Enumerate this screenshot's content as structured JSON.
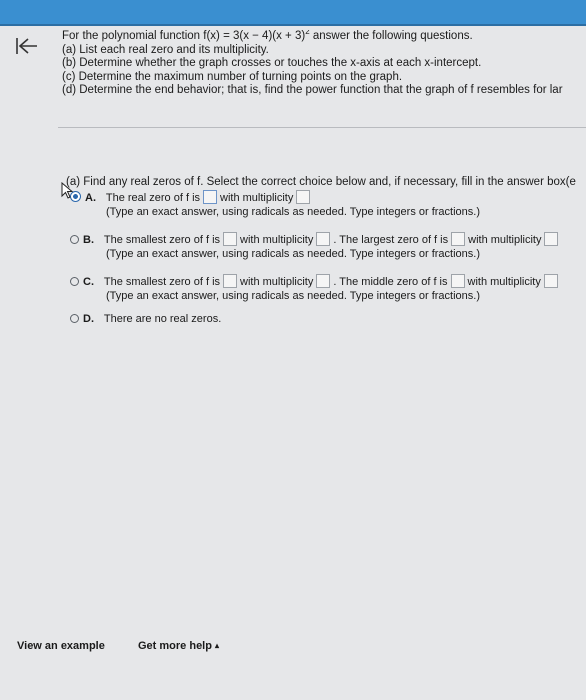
{
  "question": {
    "prompt_start": "For the polynomial function f(x) = 3(x − 4)(x + 3)",
    "exponent": "2",
    "prompt_end": " answer the following questions.",
    "tasks": [
      "(a) List each real zero and its multiplicity.",
      "(b) Determine whether the graph crosses or touches the x-axis at each x-intercept.",
      "(c) Determine the maximum number of turning points on the graph.",
      "(d) Determine the end behavior; that is, find the power function that the graph of f resembles for lar"
    ]
  },
  "part_a": {
    "instruction": "(a) Find any real zeros of f. Select the correct choice below and, if necessary, fill in the answer box(e",
    "choices": [
      {
        "letter": "A.",
        "t1": "The real zero of f is",
        "t2": "with multiplicity",
        "note": "(Type an exact answer, using radicals as needed. Type integers or fractions.)"
      },
      {
        "letter": "B.",
        "t1": "The smallest zero of f is",
        "t2": "with multiplicity",
        "t3": ". The largest zero of f is",
        "t4": "with multiplicity",
        "note": "(Type an exact answer, using radicals as needed. Type integers or fractions.)"
      },
      {
        "letter": "C.",
        "t1": "The smallest zero of f is",
        "t2": "with multiplicity",
        "t3": ". The middle zero of f is",
        "t4": "with multiplicity",
        "note": "(Type an exact answer, using radicals as needed. Type integers or fractions.)"
      },
      {
        "letter": "D.",
        "t1": "There are no real zeros."
      }
    ]
  },
  "footer": {
    "view_example": "View an example",
    "get_more_help": "Get more help",
    "help_arrow": "▴"
  }
}
